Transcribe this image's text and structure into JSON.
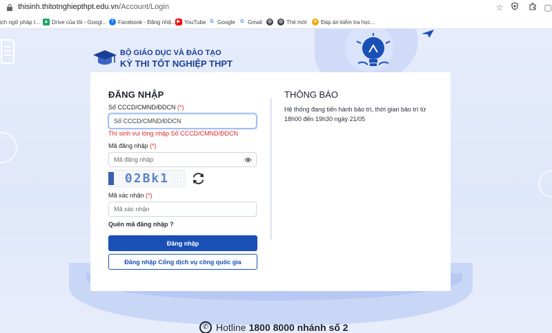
{
  "browser": {
    "url_domain": "thisinh.thitotnghiepthpt.edu.vn",
    "url_path": "/Account/Login",
    "bookmarks": [
      {
        "label": "ịch ngữ pháp t...",
        "icon": "bookmark-icon",
        "color": "#9aa0a6"
      },
      {
        "label": "Drive của tôi - Googl...",
        "icon": "drive-icon",
        "color": "#1fa463"
      },
      {
        "label": "Facebook - Đăng nhậ...",
        "icon": "facebook-icon",
        "color": "#1877f2"
      },
      {
        "label": "YouTube",
        "icon": "youtube-icon",
        "color": "#ff0000"
      },
      {
        "label": "Google",
        "icon": "google-icon",
        "color": "#4285f4"
      },
      {
        "label": "Gmail",
        "icon": "google-icon",
        "color": "#4285f4"
      },
      {
        "label": "",
        "icon": "globe-icon",
        "color": "#3c4043"
      },
      {
        "label": "Thẻ mới",
        "icon": "globe-icon",
        "color": "#3c4043"
      },
      {
        "label": "Đáp án kiểm tra học...",
        "icon": "bookmark-icon",
        "color": "#f2a400"
      }
    ]
  },
  "header": {
    "ministry": "BỘ GIÁO DỤC VÀ ĐÀO TẠO",
    "exam": "KỲ THI TỐT NGHIỆP THPT"
  },
  "login": {
    "title": "ĐĂNG NHẬP",
    "id_label": "Số CCCD/CMND/ĐDCN",
    "required_mark": "(*)",
    "id_placeholder": "Số CCCD/CMND/ĐDCN",
    "id_error": "Thí sinh vui lòng nhập Số CCCD/CMND/ĐDCN",
    "password_label": "Mã đăng nhập",
    "password_placeholder": "Mã đăng nhập",
    "captcha_text": "02Bk1",
    "captcha_label": "Mã xác nhận",
    "captcha_placeholder": "Mã xác nhận",
    "forgot": "Quên mã đăng nhập ?",
    "submit": "Đăng nhập",
    "national_portal": "Đăng nhập Cổng dịch vụ công quốc gia"
  },
  "notice": {
    "title": "THÔNG BÁO",
    "text": "Hệ thống đang tiến hành bảo trì, thời gian bảo trì từ 18h00 đến 19h30 ngày 21/05"
  },
  "footer": {
    "hotline_label": "Hotline",
    "hotline_number": "1800 8000 nhánh số 2"
  },
  "colors": {
    "primary": "#1a4fb5",
    "brand_text": "#1b3f96",
    "error": "#d9262b",
    "background": "#e2e9fb"
  }
}
